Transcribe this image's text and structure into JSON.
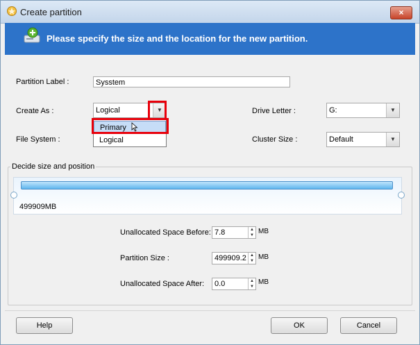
{
  "window": {
    "title": "Create partition",
    "close_label": "×"
  },
  "banner": {
    "text": "Please specify the size and the location for the new partition."
  },
  "form": {
    "partition_label": {
      "label": "Partition Label :",
      "value": "Sysstem"
    },
    "create_as": {
      "label": "Create As :",
      "value": "Logical",
      "options": [
        "Primary",
        "Logical"
      ]
    },
    "drive_letter": {
      "label": "Drive Letter :",
      "value": "G:"
    },
    "file_system": {
      "label": "File System :"
    },
    "cluster_size": {
      "label": "Cluster Size :",
      "value": "Default"
    }
  },
  "size_group": {
    "title": "Decide size and position",
    "disk_size": "499909MB",
    "unallocated_before": {
      "label": "Unallocated Space Before:",
      "value": "7.8",
      "unit": "MB"
    },
    "partition_size": {
      "label": "Partition Size :",
      "value": "499909.2",
      "unit": "MB"
    },
    "unallocated_after": {
      "label": "Unallocated Space After:",
      "value": "0.0",
      "unit": "MB"
    }
  },
  "footer": {
    "help": "Help",
    "ok": "OK",
    "cancel": "Cancel"
  },
  "colors": {
    "banner": "#2d73c9",
    "highlight": "#e8000b",
    "selection": "#c6ddf7"
  }
}
